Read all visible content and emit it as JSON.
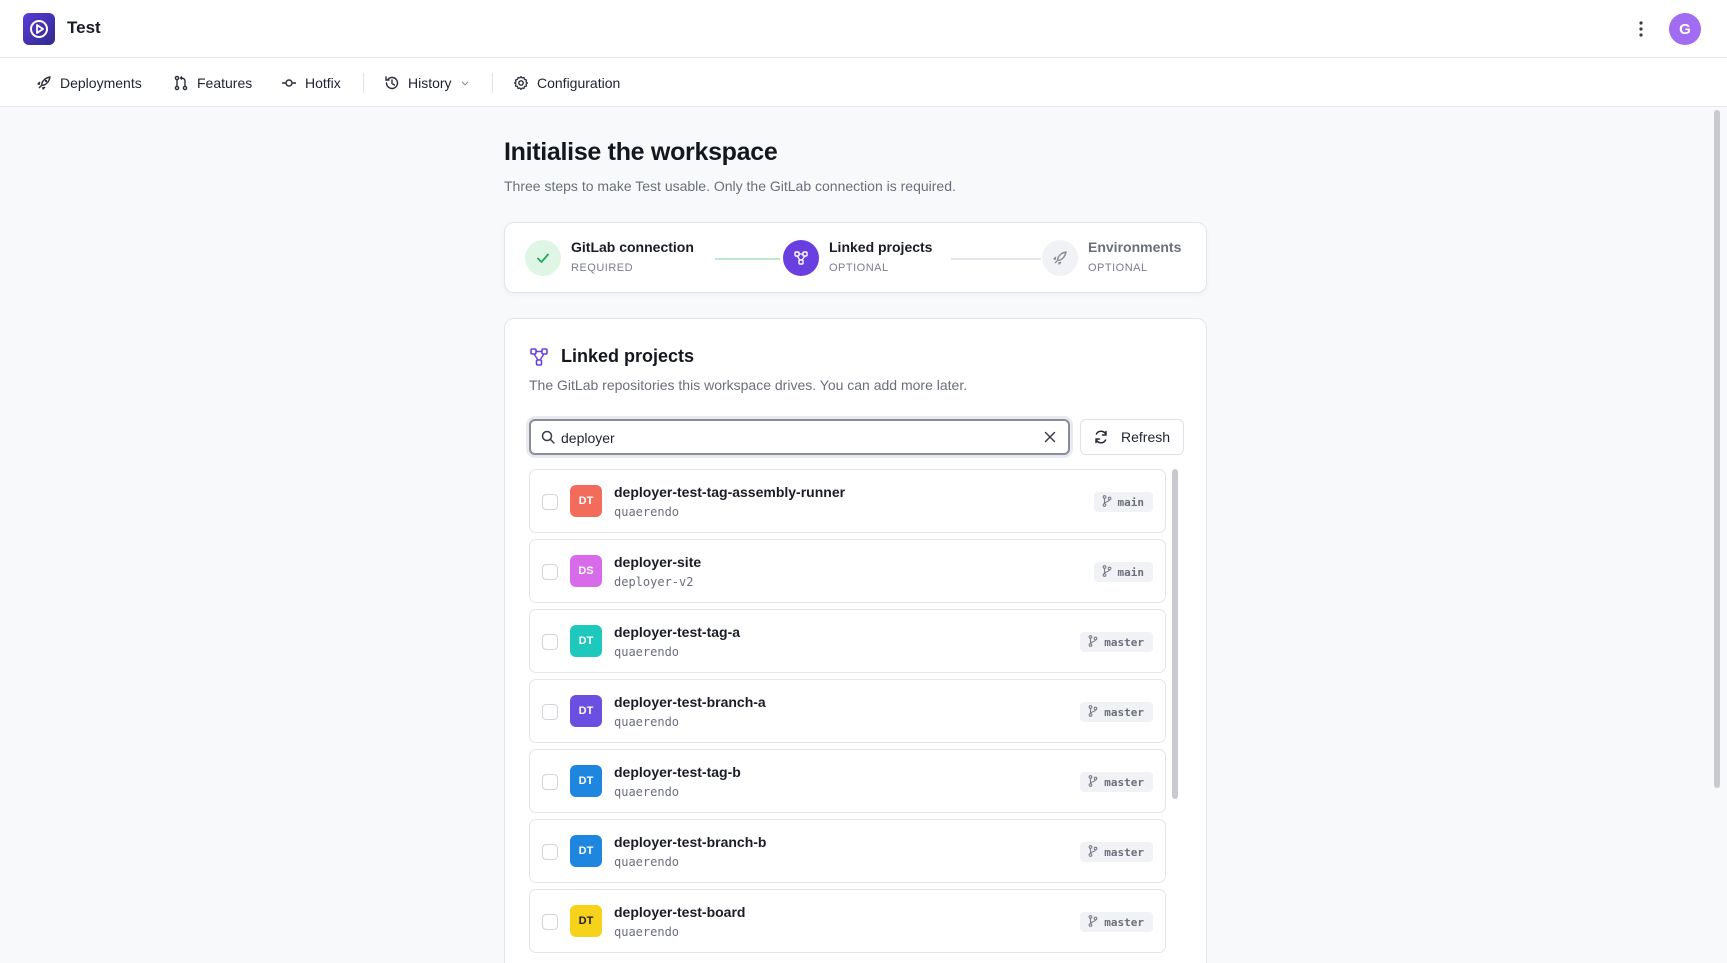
{
  "app": {
    "title": "Test",
    "avatar_initial": "G"
  },
  "nav": {
    "items": [
      {
        "label": "Deployments",
        "icon": "rocket-icon"
      },
      {
        "label": "Features",
        "icon": "merge-icon"
      },
      {
        "label": "Hotfix",
        "icon": "commit-icon"
      },
      {
        "label": "History",
        "icon": "history-icon"
      },
      {
        "label": "Configuration",
        "icon": "gear-icon"
      }
    ]
  },
  "page": {
    "title": "Initialise the workspace",
    "subtitle": "Three steps to make Test usable. Only the GitLab connection is required."
  },
  "steps": [
    {
      "title": "GitLab connection",
      "sub": "REQUIRED",
      "state": "done"
    },
    {
      "title": "Linked projects",
      "sub": "OPTIONAL",
      "state": "active"
    },
    {
      "title": "Environments",
      "sub": "OPTIONAL",
      "state": "pending"
    }
  ],
  "card": {
    "title": "Linked projects",
    "subtitle": "The GitLab repositories this workspace drives. You can add more later.",
    "search_value": "deployer",
    "refresh_label": "Refresh"
  },
  "projects": [
    {
      "initials": "DT",
      "name": "deployer-test-tag-assembly-runner",
      "namespace": "quaerendo",
      "branch": "main",
      "color": "#f26b5b"
    },
    {
      "initials": "DS",
      "name": "deployer-site",
      "namespace": "deployer-v2",
      "branch": "main",
      "color": "#d86bea"
    },
    {
      "initials": "DT",
      "name": "deployer-test-tag-a",
      "namespace": "quaerendo",
      "branch": "master",
      "color": "#1ec8bd"
    },
    {
      "initials": "DT",
      "name": "deployer-test-branch-a",
      "namespace": "quaerendo",
      "branch": "master",
      "color": "#6b4fe0"
    },
    {
      "initials": "DT",
      "name": "deployer-test-tag-b",
      "namespace": "quaerendo",
      "branch": "master",
      "color": "#1f86e0"
    },
    {
      "initials": "DT",
      "name": "deployer-test-branch-b",
      "namespace": "quaerendo",
      "branch": "master",
      "color": "#1f86e0"
    },
    {
      "initials": "DT",
      "name": "deployer-test-board",
      "namespace": "quaerendo",
      "branch": "master",
      "color": "#f7d21a"
    }
  ],
  "colors": {
    "accent": "#6a3fe0",
    "success": "#22a85a",
    "success_bg": "#dff6e6"
  }
}
